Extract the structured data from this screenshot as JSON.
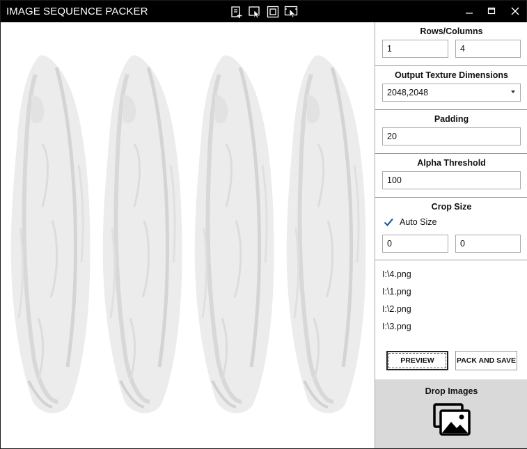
{
  "app": {
    "title": "IMAGE SEQUENCE PACKER"
  },
  "title_toolbar": {
    "buttons": [
      "add-file-icon",
      "select-cursor-icon",
      "fit-frame-icon",
      "screen-select-icon"
    ]
  },
  "window_controls": {
    "minimize": "—",
    "maximize": "☐",
    "close": "✕"
  },
  "settings": {
    "rows_columns": {
      "label": "Rows/Columns",
      "rows": "1",
      "columns": "4"
    },
    "output_texture": {
      "label": "Output Texture Dimensions",
      "selected": "2048,2048"
    },
    "padding": {
      "label": "Padding",
      "value": "20"
    },
    "alpha_threshold": {
      "label": "Alpha Threshold",
      "value": "100"
    },
    "crop_size": {
      "label": "Crop Size",
      "auto_size_label": "Auto Size",
      "auto_size_checked": true,
      "width": "0",
      "height": "0"
    }
  },
  "files": [
    "I:\\4.png",
    "I:\\1.png",
    "I:\\2.png",
    "I:\\3.png"
  ],
  "actions": {
    "preview": "PREVIEW",
    "pack_and_save": "PACK AND SAVE"
  },
  "drop_zone": {
    "label": "Drop Images"
  },
  "preview": {
    "sprite_count": 4
  },
  "colors": {
    "titlebar": "#000000",
    "drop_zone": "#d9d9d9",
    "checkbox_accent": "#1f5fa8"
  }
}
